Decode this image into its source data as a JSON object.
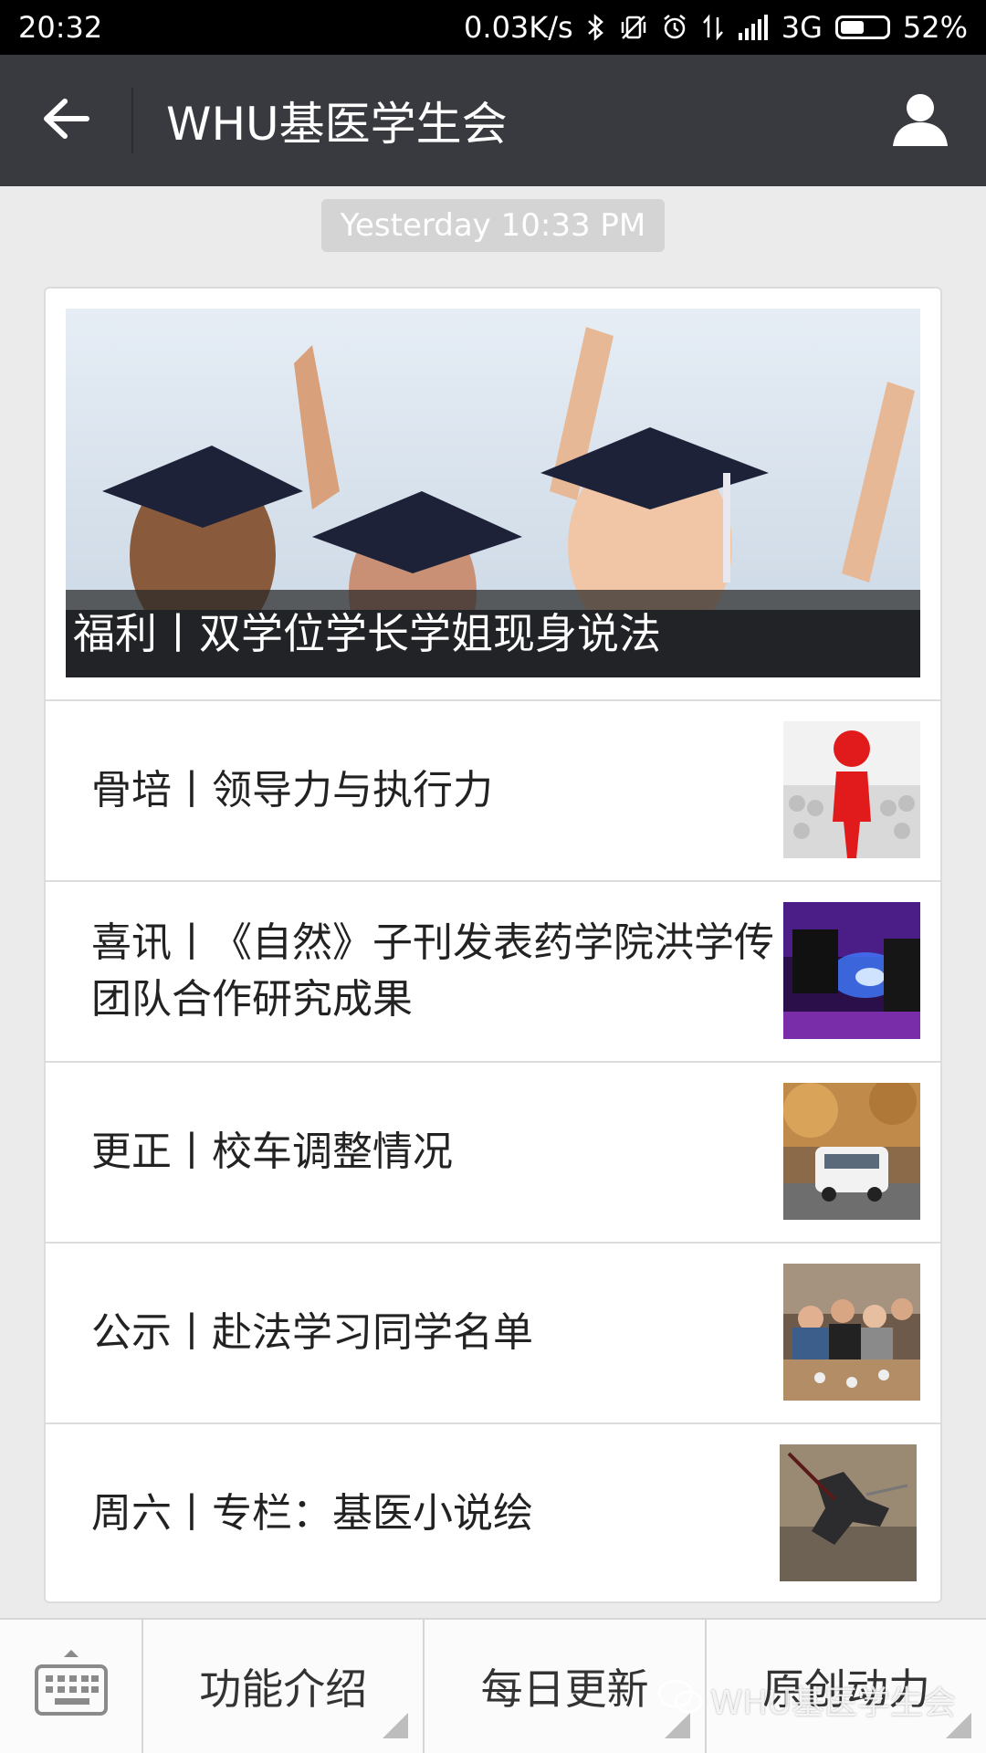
{
  "status_bar": {
    "time": "20:32",
    "speed": "0.03K/s",
    "network": "3G",
    "battery": "52%",
    "battery_level": 0.52
  },
  "app_bar": {
    "title": "WHU基医学生会",
    "back_icon": "arrow-left-icon",
    "profile_icon": "person-icon"
  },
  "chat": {
    "timestamp": "Yesterday 10:33 PM"
  },
  "article_card": {
    "hero": {
      "title": "福利丨双学位学长学姐现身说法",
      "image": "graduates-in-caps-photo"
    },
    "items": [
      {
        "title": "骨培丨领导力与执行力",
        "image": "red-figure-leader-photo"
      },
      {
        "title": "喜讯丨《自然》子刊发表药学院洪学传团队合作研究成果",
        "image": "lab-equipment-blue-light-photo"
      },
      {
        "title": "更正丨校车调整情况",
        "image": "campus-bus-street-photo"
      },
      {
        "title": "公示丨赴法学习同学名单",
        "image": "students-group-cafe-photo"
      },
      {
        "title": "周六丨专栏：基医小说绘",
        "image": "dark-warrior-artwork"
      }
    ]
  },
  "bottom_menu": {
    "keyboard_icon": "keyboard-icon",
    "items": [
      {
        "label": "功能介绍"
      },
      {
        "label": "每日更新"
      },
      {
        "label": "原创动力"
      }
    ]
  },
  "watermark": "WHU基医学生会",
  "colors": {
    "app_bar_bg": "#393a3f",
    "page_bg": "#ebebeb",
    "status_bar_bg": "#000000"
  }
}
